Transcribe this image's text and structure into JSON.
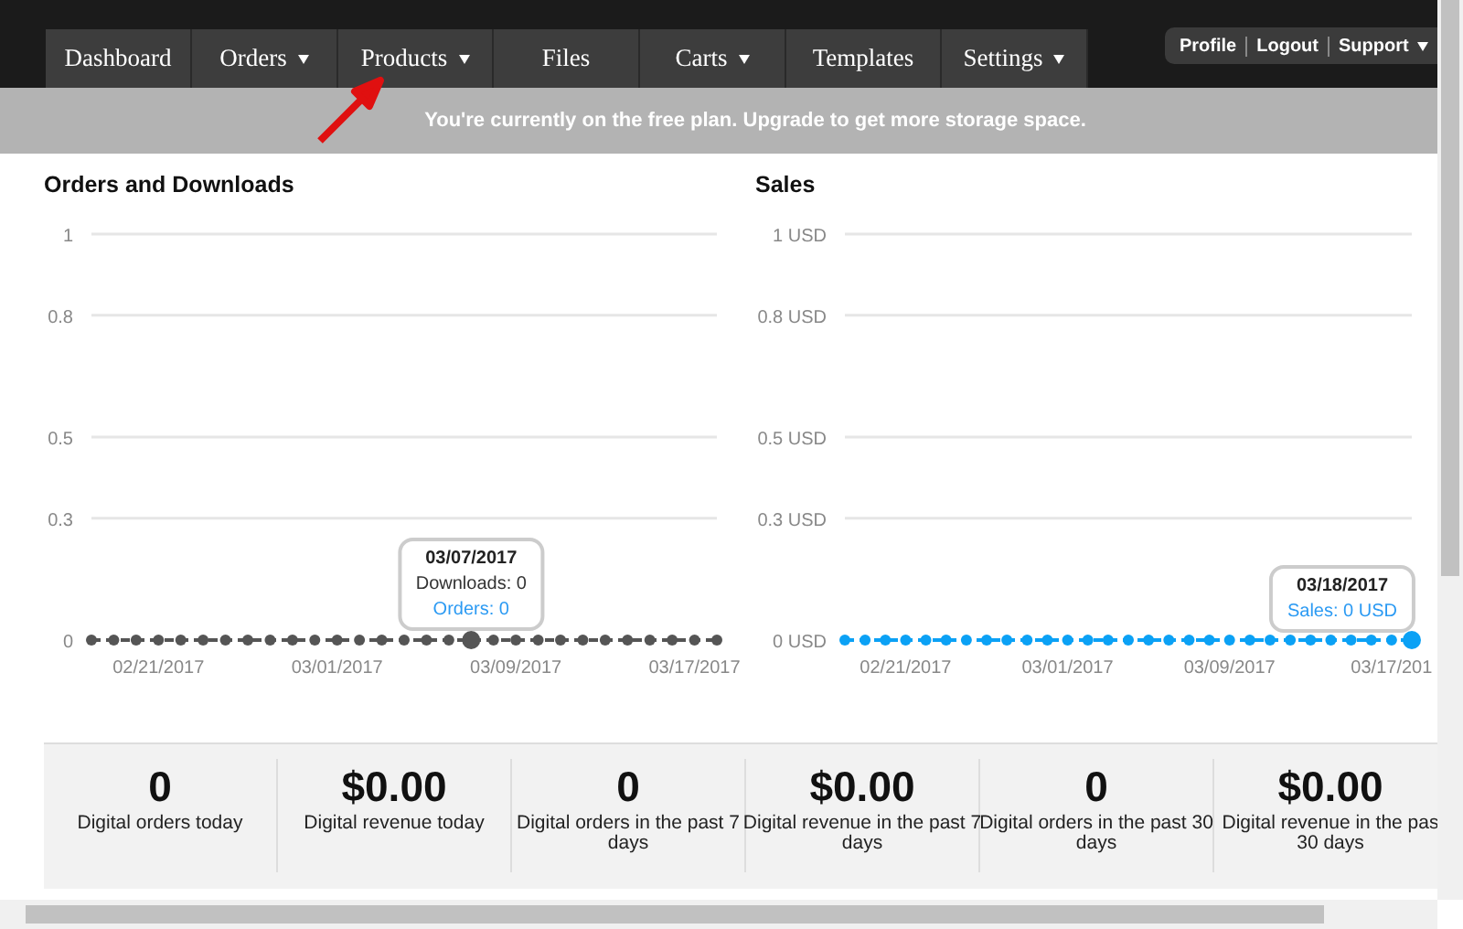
{
  "nav": {
    "tabs": [
      {
        "label": "Dashboard",
        "dropdown": false,
        "selected": false
      },
      {
        "label": "Orders",
        "dropdown": true,
        "selected": false
      },
      {
        "label": "Products",
        "dropdown": true,
        "selected": false
      },
      {
        "label": "Files",
        "dropdown": false,
        "selected": false
      },
      {
        "label": "Carts",
        "dropdown": true,
        "selected": false
      },
      {
        "label": "Templates",
        "dropdown": false,
        "selected": false
      },
      {
        "label": "Settings",
        "dropdown": true,
        "selected": false
      }
    ],
    "user_menu": [
      {
        "label": "Profile",
        "dropdown": false
      },
      {
        "label": "Logout",
        "dropdown": false
      },
      {
        "label": "Support",
        "dropdown": true
      }
    ]
  },
  "banner": "You're currently on the free plan. Upgrade to get more storage space.",
  "charts": [
    {
      "title": "Orders and Downloads",
      "chart_data": {
        "type": "line",
        "grid": true,
        "categories": [
          null,
          null,
          null,
          "02/21/2017",
          null,
          null,
          null,
          null,
          null,
          null,
          null,
          "03/01/2017",
          null,
          null,
          null,
          null,
          null,
          null,
          null,
          "03/09/2017",
          null,
          null,
          null,
          null,
          null,
          null,
          null,
          "03/17/2017",
          null
        ],
        "series": [
          {
            "color": "#555555",
            "line_style": "dashed",
            "marker": "circle",
            "values": [
              0,
              0,
              0,
              0,
              0,
              0,
              0,
              0,
              0,
              0,
              0,
              0,
              0,
              0,
              0,
              0,
              0,
              0,
              0,
              0,
              0,
              0,
              0,
              0,
              0,
              0,
              0,
              0,
              0
            ]
          }
        ],
        "ylim": [
          0,
          1
        ],
        "yticks": [
          0,
          0.3,
          0.5,
          0.8,
          1
        ]
      },
      "tooltip_date": "03/07/2017",
      "tooltip_lines": [
        {
          "text": "Downloads: 0",
          "color": "#333333"
        },
        {
          "text": "Orders: 0",
          "color": "#2b9af3"
        }
      ]
    },
    {
      "title": "Sales",
      "chart_data": {
        "type": "line",
        "grid": true,
        "categories": [
          null,
          null,
          null,
          "02/21/2017",
          null,
          null,
          null,
          null,
          null,
          null,
          null,
          "03/01/2017",
          null,
          null,
          null,
          null,
          null,
          null,
          null,
          "03/09/2017",
          null,
          null,
          null,
          null,
          null,
          null,
          null,
          "03/17/201",
          null
        ],
        "series": [
          {
            "color": "#0ba1f5",
            "line_style": "dashed",
            "marker": "circle",
            "values": [
              0,
              0,
              0,
              0,
              0,
              0,
              0,
              0,
              0,
              0,
              0,
              0,
              0,
              0,
              0,
              0,
              0,
              0,
              0,
              0,
              0,
              0,
              0,
              0,
              0,
              0,
              0,
              0,
              0
            ]
          }
        ],
        "ylim": [
          0,
          1
        ],
        "yticks": [
          {
            "value": 0,
            "label": "0 USD"
          },
          {
            "value": 0.3,
            "label": "0.3 USD"
          },
          {
            "value": 0.5,
            "label": "0.5 USD"
          },
          {
            "value": 0.8,
            "label": "0.8 USD"
          },
          {
            "value": 1,
            "label": "1 USD"
          }
        ]
      },
      "tooltip_date": "03/18/2017",
      "tooltip_lines": [
        {
          "text": "Sales: 0 USD",
          "color": "#2b9af3"
        }
      ]
    }
  ],
  "stats": [
    {
      "value": "0",
      "label_lines": [
        "Digital orders today"
      ]
    },
    {
      "value": "$0.00",
      "label_lines": [
        "Digital revenue today"
      ]
    },
    {
      "value": "0",
      "label_lines": [
        "Digital orders in the past 7",
        "days"
      ]
    },
    {
      "value": "$0.00",
      "label_lines": [
        "Digital revenue in the past 7",
        "days"
      ]
    },
    {
      "value": "0",
      "label_lines": [
        "Digital orders in the past 30",
        "days"
      ]
    },
    {
      "value": "$0.00",
      "label_lines": [
        "Digital revenue in the pas",
        "30 days"
      ]
    }
  ]
}
